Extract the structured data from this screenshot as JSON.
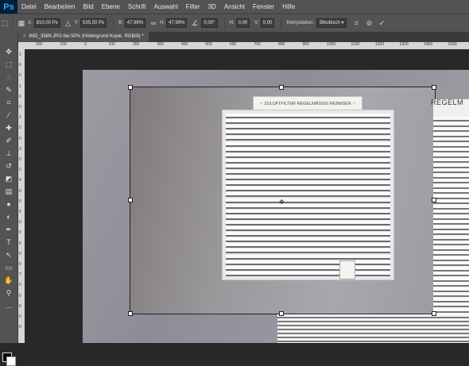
{
  "app": {
    "logo": "Ps"
  },
  "menu": [
    "Datei",
    "Bearbeiten",
    "Bild",
    "Ebene",
    "Schrift",
    "Auswahl",
    "Filter",
    "3D",
    "Ansicht",
    "Fenster",
    "Hilfe"
  ],
  "options": {
    "x_label": "X:",
    "x_value": "810,00 Px",
    "y_label": "Y:",
    "y_value": "535,50 Px",
    "w_label": "B:",
    "w_value": "47,99%",
    "h_label": "H:",
    "h_value": "47,99%",
    "angle_value": "0,00",
    "angle_unit": "°",
    "hskew_label": "H:",
    "hskew_value": "0,00",
    "vskew_label": "V:",
    "vskew_value": "0,00",
    "interp_label": "Interpolation:",
    "interp_value": "Bikubisch"
  },
  "document": {
    "tab_title": "IMG_3589.JPG bei 50% (Hintergrund Kopie, RGB/8) *",
    "close": "×"
  },
  "ruler": {
    "h_ticks": [
      "200",
      "100",
      "0",
      "100",
      "200",
      "300",
      "400",
      "500",
      "600",
      "700",
      "800",
      "900",
      "1000",
      "1100",
      "1200",
      "1300",
      "1400",
      "1500"
    ],
    "v_ticks": [
      "1",
      "0",
      "0",
      "1",
      "0",
      "0",
      "2",
      "0",
      "0",
      "3",
      "0",
      "0",
      "4",
      "0",
      "0",
      "5",
      "0",
      "0",
      "6",
      "0",
      "0",
      "7",
      "0",
      "0",
      "8",
      "0",
      "0"
    ]
  },
  "image": {
    "sign_text": "☞ ZULUFTFILTER REGELMÄSSIG REINIGEN ☜",
    "right_label": "REGELM"
  },
  "colors": {
    "accent": "#31a8ff",
    "panel": "#535353",
    "background": "#282828"
  }
}
